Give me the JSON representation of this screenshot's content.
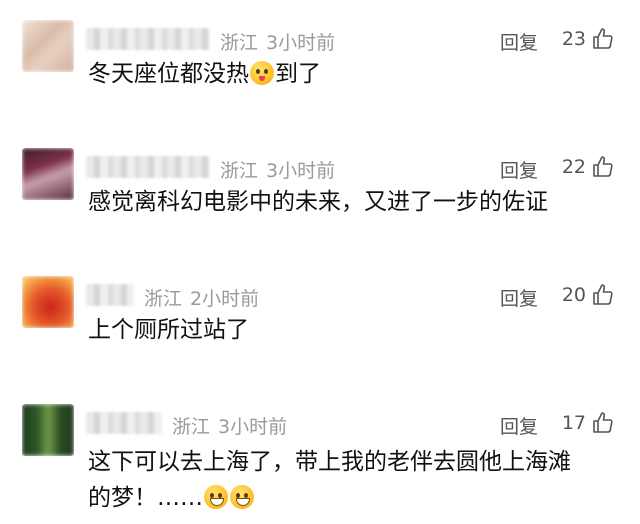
{
  "comments": [
    {
      "location": "浙江",
      "time": "3小时前",
      "reply_label": "回复",
      "likes": "23",
      "text_parts": [
        "冬天座位都没热",
        "到了"
      ],
      "emoji": "winking-face-tongue-icon",
      "avatar_colors": [
        "#e9d3c4",
        "#d8b9a6",
        "#f3e6dc"
      ]
    },
    {
      "location": "浙江",
      "time": "3小时前",
      "reply_label": "回复",
      "likes": "22",
      "text_parts": [
        "感觉离科幻电影中的未来，又进了一步的佐证"
      ],
      "emoji": "",
      "avatar_colors": [
        "#7b2f4a",
        "#c8a0b0",
        "#3b1f2c"
      ]
    },
    {
      "location": "浙江",
      "time": "2小时前",
      "reply_label": "回复",
      "likes": "20",
      "text_parts": [
        "上个厕所过站了"
      ],
      "emoji": "",
      "avatar_colors": [
        "#e65c2a",
        "#c9231b",
        "#f6b04a"
      ]
    },
    {
      "location": "浙江",
      "time": "3小时前",
      "reply_label": "回复",
      "likes": "17",
      "text_parts": [
        "这下可以去上海了，带上我的老伴去圆他上海滩",
        "的梦！……"
      ],
      "emoji": "grinning-face-icon",
      "avatar_colors": [
        "#2f5a2a",
        "#6f9a4a",
        "#1e3a1a"
      ]
    }
  ],
  "colors": {
    "meta": "#9a9a9a",
    "text": "#111111",
    "action": "#555555"
  }
}
